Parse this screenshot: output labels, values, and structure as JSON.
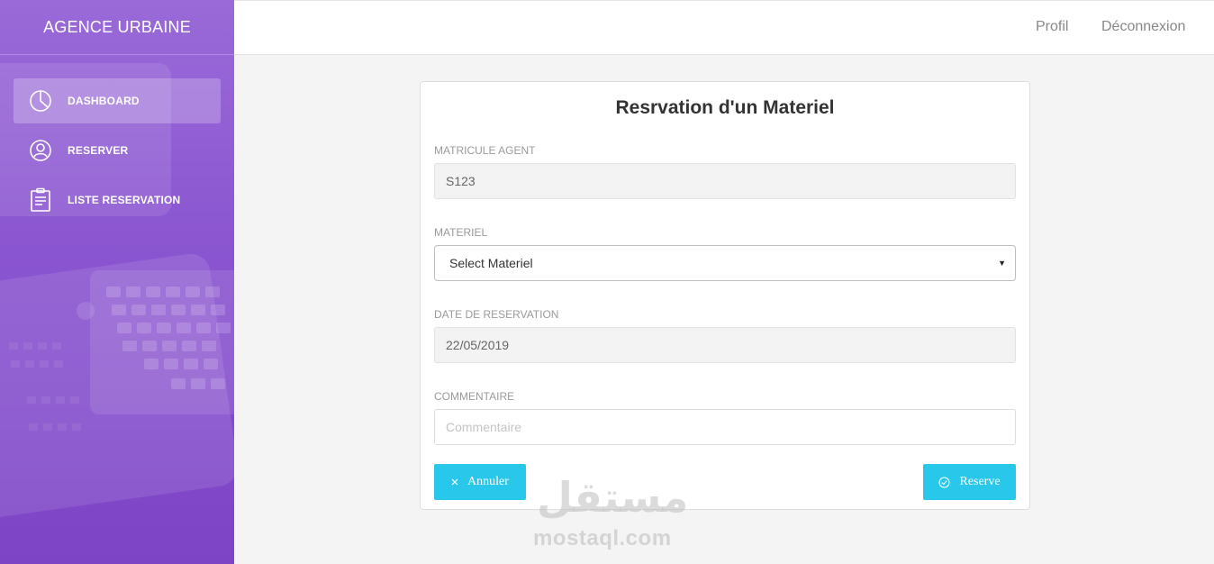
{
  "brand": "AGENCE URBAINE",
  "topbar": {
    "profil": "Profil",
    "logout": "Déconnexion"
  },
  "sidebar": {
    "items": [
      {
        "label": "DASHBOARD",
        "icon": "pie-chart-icon",
        "active": true
      },
      {
        "label": "RESERVER",
        "icon": "user-icon",
        "active": false
      },
      {
        "label": "LISTE RESERVATION",
        "icon": "clipboard-icon",
        "active": false
      }
    ]
  },
  "form": {
    "title": "Resrvation d'un Materiel",
    "matricule": {
      "label": "MATRICULE AGENT",
      "value": "S123"
    },
    "materiel": {
      "label": "MATERIEL",
      "value": "Select Materiel"
    },
    "date": {
      "label": "DATE DE RESERVATION",
      "value": "22/05/2019"
    },
    "commentaire": {
      "label": "COMMENTAIRE",
      "placeholder": "Commentaire"
    },
    "cancel_label": "Annuler",
    "reserve_label": "Reserve"
  },
  "watermark": {
    "arabic": "مستقل",
    "latin": "mostaql.com"
  },
  "colors": {
    "sidebar": "#8a55d0",
    "accent": "#29c7ea"
  }
}
